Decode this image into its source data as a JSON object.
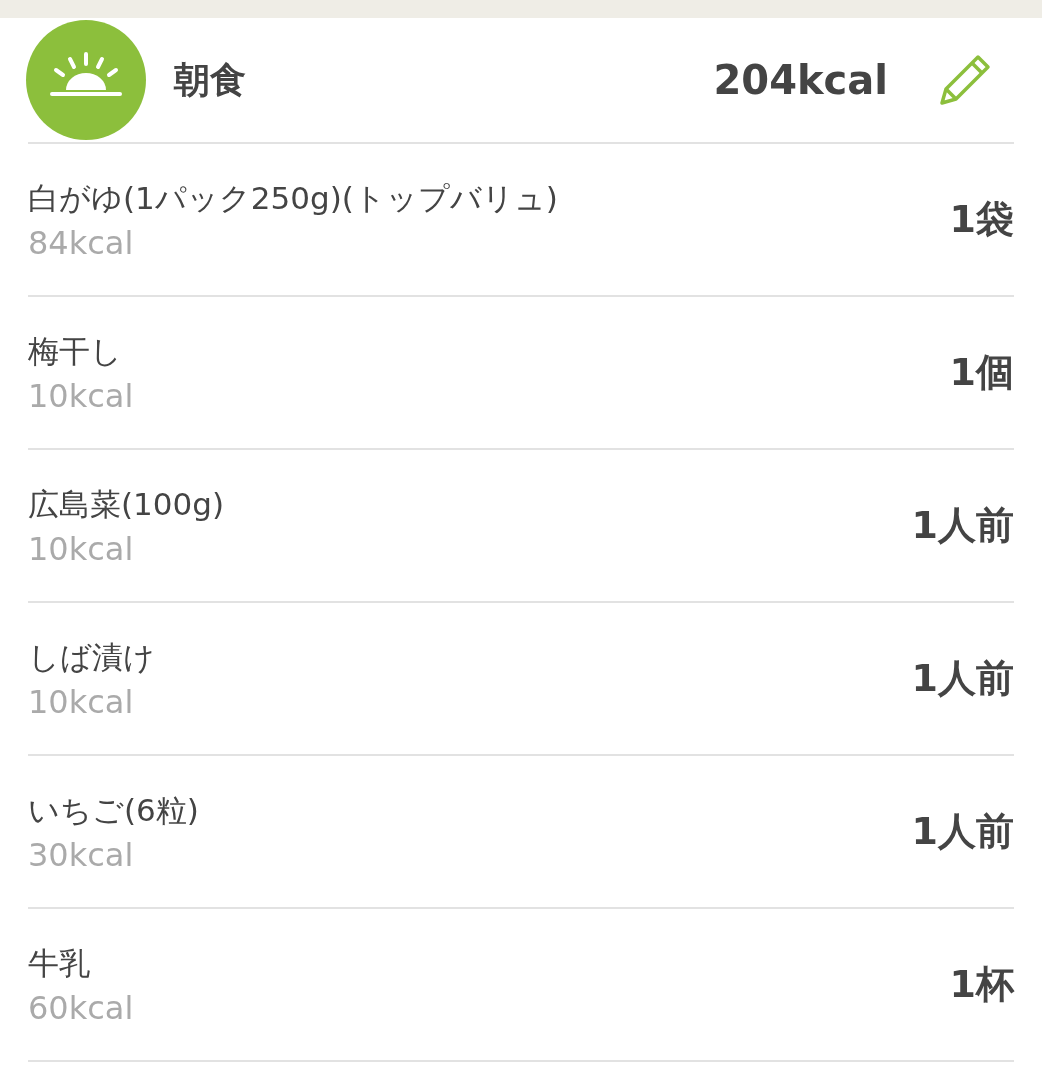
{
  "meal": {
    "title": "朝食",
    "kcal": "204kcal"
  },
  "items": [
    {
      "name": "白がゆ(1パック250g)(トップバリュ)",
      "kcal": "84kcal",
      "quantity": "1袋"
    },
    {
      "name": "梅干し",
      "kcal": "10kcal",
      "quantity": "1個"
    },
    {
      "name": "広島菜(100g)",
      "kcal": "10kcal",
      "quantity": "1人前"
    },
    {
      "name": "しば漬け",
      "kcal": "10kcal",
      "quantity": "1人前"
    },
    {
      "name": "いちご(6粒)",
      "kcal": "30kcal",
      "quantity": "1人前"
    },
    {
      "name": "牛乳",
      "kcal": "60kcal",
      "quantity": "1杯"
    }
  ]
}
